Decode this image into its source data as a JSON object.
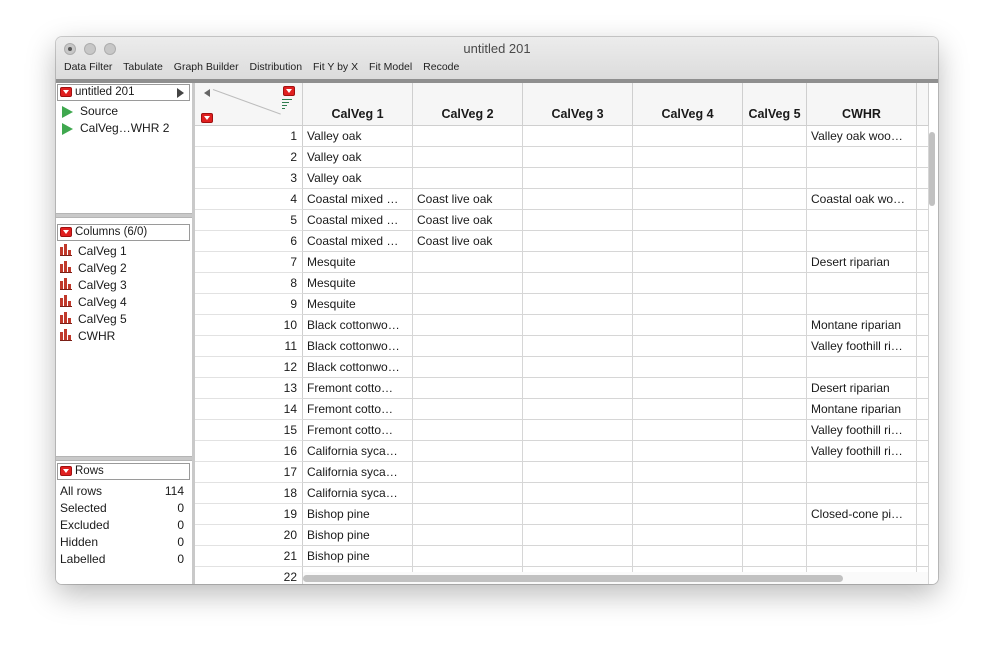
{
  "window": {
    "title": "untitled 201",
    "menu": [
      "Data Filter",
      "Tabulate",
      "Graph Builder",
      "Distribution",
      "Fit Y by X",
      "Fit Model",
      "Recode"
    ]
  },
  "table_panel": {
    "name": "untitled 201",
    "items": [
      "Source",
      "CalVeg…WHR 2"
    ]
  },
  "columns_panel": {
    "header": "Columns (6/0)",
    "items": [
      "CalVeg 1",
      "CalVeg 2",
      "CalVeg 3",
      "CalVeg 4",
      "CalVeg 5",
      "CWHR"
    ]
  },
  "rows_panel": {
    "header": "Rows",
    "stats": [
      {
        "label": "All rows",
        "value": "114"
      },
      {
        "label": "Selected",
        "value": "0"
      },
      {
        "label": "Excluded",
        "value": "0"
      },
      {
        "label": "Hidden",
        "value": "0"
      },
      {
        "label": "Labelled",
        "value": "0"
      }
    ]
  },
  "grid": {
    "columns": [
      "CalVeg 1",
      "CalVeg 2",
      "CalVeg 3",
      "CalVeg 4",
      "CalVeg 5",
      "CWHR"
    ],
    "rows": [
      {
        "n": "1",
        "cells": [
          "Valley oak",
          "",
          "",
          "",
          "",
          "Valley oak woo…"
        ]
      },
      {
        "n": "2",
        "cells": [
          "Valley oak",
          "",
          "",
          "",
          "",
          ""
        ]
      },
      {
        "n": "3",
        "cells": [
          "Valley oak",
          "",
          "",
          "",
          "",
          ""
        ]
      },
      {
        "n": "4",
        "cells": [
          "Coastal mixed …",
          "Coast live oak",
          "",
          "",
          "",
          "Coastal oak wo…"
        ]
      },
      {
        "n": "5",
        "cells": [
          "Coastal mixed …",
          "Coast live oak",
          "",
          "",
          "",
          ""
        ]
      },
      {
        "n": "6",
        "cells": [
          "Coastal mixed …",
          "Coast live oak",
          "",
          "",
          "",
          ""
        ]
      },
      {
        "n": "7",
        "cells": [
          "Mesquite",
          "",
          "",
          "",
          "",
          "Desert riparian"
        ]
      },
      {
        "n": "8",
        "cells": [
          "Mesquite",
          "",
          "",
          "",
          "",
          ""
        ]
      },
      {
        "n": "9",
        "cells": [
          "Mesquite",
          "",
          "",
          "",
          "",
          ""
        ]
      },
      {
        "n": "10",
        "cells": [
          "Black cottonwo…",
          "",
          "",
          "",
          "",
          "Montane riparian"
        ]
      },
      {
        "n": "11",
        "cells": [
          "Black cottonwo…",
          "",
          "",
          "",
          "",
          "Valley foothill ri…"
        ]
      },
      {
        "n": "12",
        "cells": [
          "Black cottonwo…",
          "",
          "",
          "",
          "",
          ""
        ]
      },
      {
        "n": "13",
        "cells": [
          "Fremont cotto…",
          "",
          "",
          "",
          "",
          "Desert riparian"
        ]
      },
      {
        "n": "14",
        "cells": [
          "Fremont cotto…",
          "",
          "",
          "",
          "",
          "Montane riparian"
        ]
      },
      {
        "n": "15",
        "cells": [
          "Fremont cotto…",
          "",
          "",
          "",
          "",
          "Valley foothill ri…"
        ]
      },
      {
        "n": "16",
        "cells": [
          "California syca…",
          "",
          "",
          "",
          "",
          "Valley foothill ri…"
        ]
      },
      {
        "n": "17",
        "cells": [
          "California syca…",
          "",
          "",
          "",
          "",
          ""
        ]
      },
      {
        "n": "18",
        "cells": [
          "California syca…",
          "",
          "",
          "",
          "",
          ""
        ]
      },
      {
        "n": "19",
        "cells": [
          "Bishop pine",
          "",
          "",
          "",
          "",
          "Closed-cone pi…"
        ]
      },
      {
        "n": "20",
        "cells": [
          "Bishop pine",
          "",
          "",
          "",
          "",
          ""
        ]
      },
      {
        "n": "21",
        "cells": [
          "Bishop pine",
          "",
          "",
          "",
          "",
          ""
        ]
      },
      {
        "n": "22",
        "cells": [
          "",
          "",
          "",
          "",
          "",
          ""
        ]
      }
    ]
  },
  "colors": {
    "accent_red": "#e02020",
    "source_green": "#3fa84f",
    "nominal_icon": "#c0392b"
  }
}
